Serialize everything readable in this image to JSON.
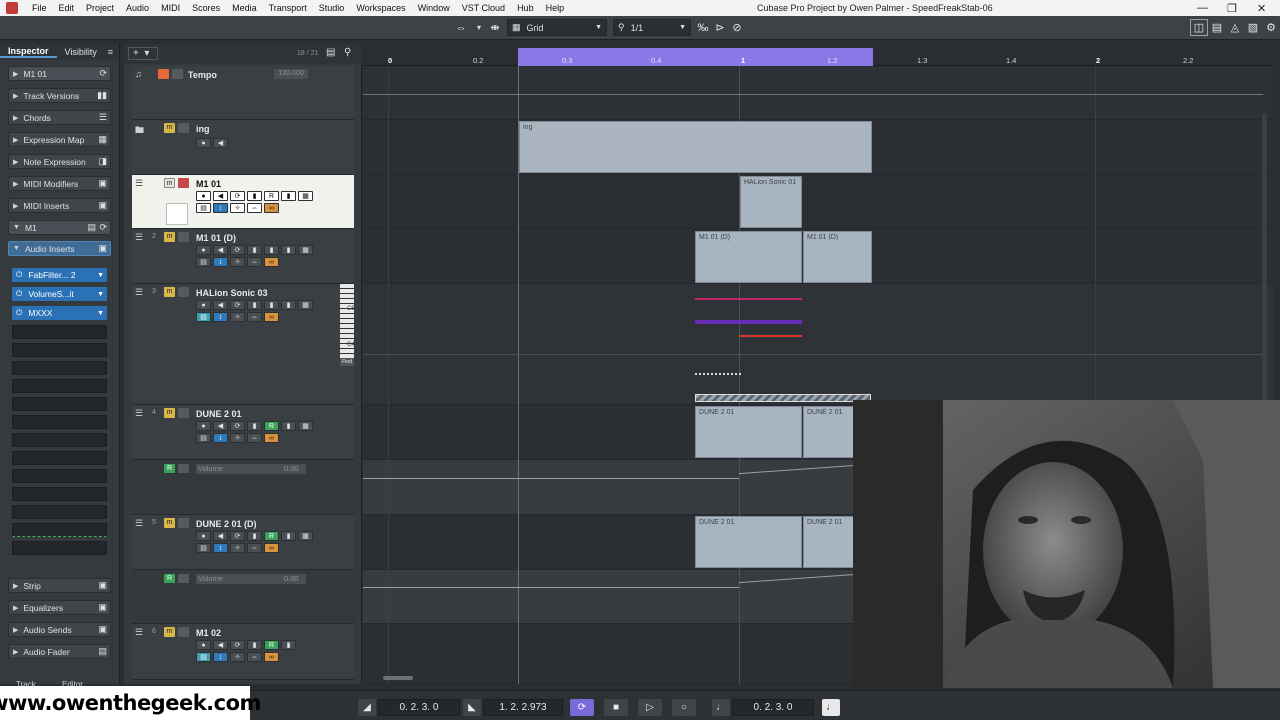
{
  "window": {
    "title": "Cubase Pro Project by Owen Palmer - SpeedFreakStab-06",
    "menu": [
      "File",
      "Edit",
      "Project",
      "Audio",
      "MIDI",
      "Scores",
      "Media",
      "Transport",
      "Studio",
      "Workspaces",
      "Window",
      "VST Cloud",
      "Hub",
      "Help"
    ]
  },
  "toolbar": {
    "snap_type": "Grid",
    "quantize": "1/1"
  },
  "inspector": {
    "tabs": [
      "Inspector",
      "Visibility"
    ],
    "track_name": "M1 01",
    "sections": [
      "Track Versions",
      "Chords",
      "Expression Map",
      "Note Expression",
      "MIDI Modifiers",
      "MIDI Inserts"
    ],
    "sub_track_name": "M1",
    "audio_inserts_label": "Audio Inserts",
    "inserts": [
      "FabFilter... 2",
      "VolumeS...it",
      "MXXX"
    ],
    "bottom_sections": [
      "Strip",
      "Equalizers",
      "Audio Sends",
      "Audio Fader"
    ],
    "bottom_tabs": [
      "Track",
      "Editor"
    ]
  },
  "tracklist": {
    "count": "18 / 21",
    "tracks": [
      {
        "name": "Tempo",
        "value": "120.000"
      },
      {
        "name": "ing"
      },
      {
        "name": "M1 01"
      },
      {
        "name": "M1 01 (D)",
        "num": "2"
      },
      {
        "name": "HALion Sonic 03",
        "num": "3"
      },
      {
        "name": "DUNE 2 01",
        "num": "4"
      },
      {
        "name": "Volume",
        "value": "0.00"
      },
      {
        "name": "DUNE 2 01 (D)",
        "num": "5"
      },
      {
        "name": "Volume",
        "value": "0.00"
      },
      {
        "name": "M1 02",
        "num": "6"
      }
    ],
    "keyboard_labels": [
      "C5",
      "C4"
    ],
    "find_label": "Find"
  },
  "ruler": {
    "labels": [
      "0",
      "0.2",
      "0.3",
      "0.4",
      "1",
      "1.2",
      "1.3",
      "1.4",
      "2",
      "2.2"
    ]
  },
  "parts": {
    "folder": "ing",
    "halion": "HALion Sonic 01",
    "m1d_a": "M1 01 (D)",
    "m1d_b": "M1 01 (D)",
    "dune_a": "DUNE 2 01",
    "dune_b": "DUNE 2 01",
    "duned_a": "DUNE 2 01",
    "duned_b": "DUNE 2 01"
  },
  "transport": {
    "left_locator": "0. 2. 3.   0",
    "right_locator": "1. 2. 2.973",
    "position": "0. 2. 3.   0"
  },
  "watermark": "www.owenthegeek.com",
  "colors": {
    "cycle_range": "#8a78e6",
    "selected_track": "#f2f2ec",
    "insert_slot": "#2a72b5",
    "part": "#a8b4bf"
  }
}
